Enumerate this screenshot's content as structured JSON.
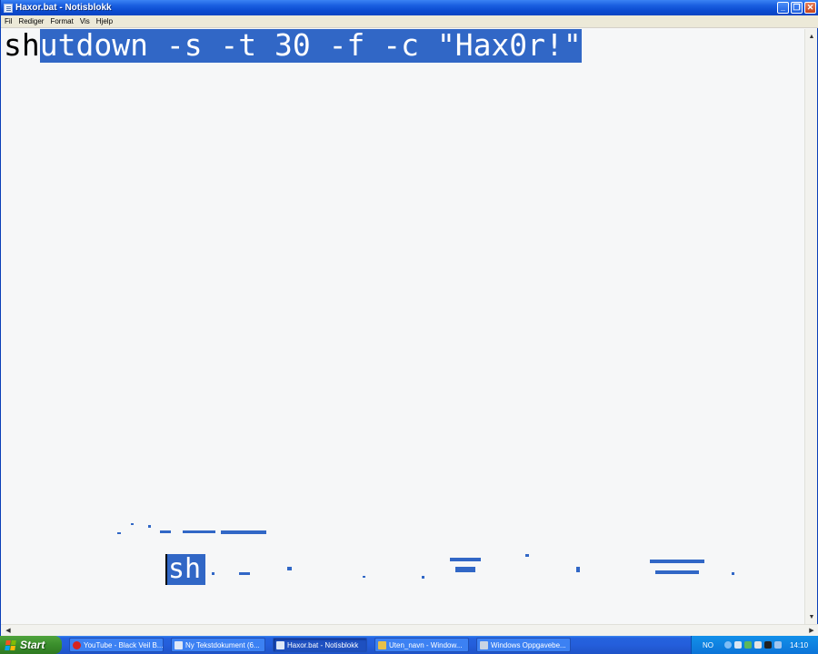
{
  "window": {
    "title": "Haxor.bat - Notisblokk"
  },
  "menu": [
    "Fil",
    "Rediger",
    "Format",
    "Vis",
    "Hjelp"
  ],
  "editor": {
    "text_unselected": "sh",
    "text_selected": "utdown -s -t 30 -f -c \"Hax0r!\""
  },
  "artifact": {
    "text": "sh"
  },
  "taskbar": {
    "start_label": "Start",
    "tasks": [
      {
        "label": "YouTube - Black Veil B...",
        "icon": "opera-icon"
      },
      {
        "label": "Ny Tekstdokument (6...",
        "icon": "notepad-icon"
      },
      {
        "label": "Haxor.bat - Notisblokk",
        "icon": "notepad-icon"
      },
      {
        "label": "Uten_navn - Window...",
        "icon": "paint-icon"
      },
      {
        "label": "Windows Oppgavebe...",
        "icon": "task-manager-icon"
      }
    ],
    "tray": {
      "language": "NO",
      "clock": "14:10"
    }
  },
  "colors": {
    "selection": "#3167c6",
    "titlebar": "#0b4bd0",
    "taskbar": "#245edb",
    "start": "#3a8e2c"
  }
}
